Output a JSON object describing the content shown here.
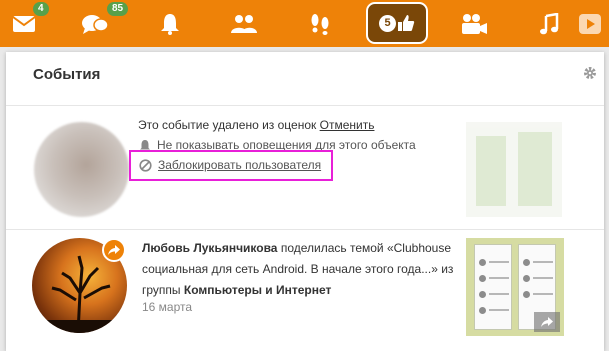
{
  "topbar": {
    "messages_badge": "4",
    "discussions_badge": "85",
    "events_count": "5",
    "icons": [
      "envelope-icon",
      "chat-bubbles-icon",
      "bell-icon",
      "friends-icon",
      "footprints-icon",
      "thumbs-up-icon",
      "video-camera-icon",
      "music-note-icon",
      "play-icon"
    ]
  },
  "panel": {
    "title": "События"
  },
  "removed_event": {
    "text": "Это событие удалено из оценок",
    "undo_label": "Отменить",
    "hide_label": "Не показывать оповещения для этого объекта",
    "block_label": "Заблокировать пользователя"
  },
  "post": {
    "author": "Любовь Лукьянчикова",
    "action": " поделилась темой «Clubhouse социальная для сеть Android. В начале этого года...» из группы ",
    "group": "Компьютеры и Интернет",
    "date": "16 марта"
  },
  "colors": {
    "topbar_bg": "#ee8208",
    "badge_green": "#58a04a",
    "active_bg": "#7a4708",
    "highlight": "#e81fd8"
  }
}
